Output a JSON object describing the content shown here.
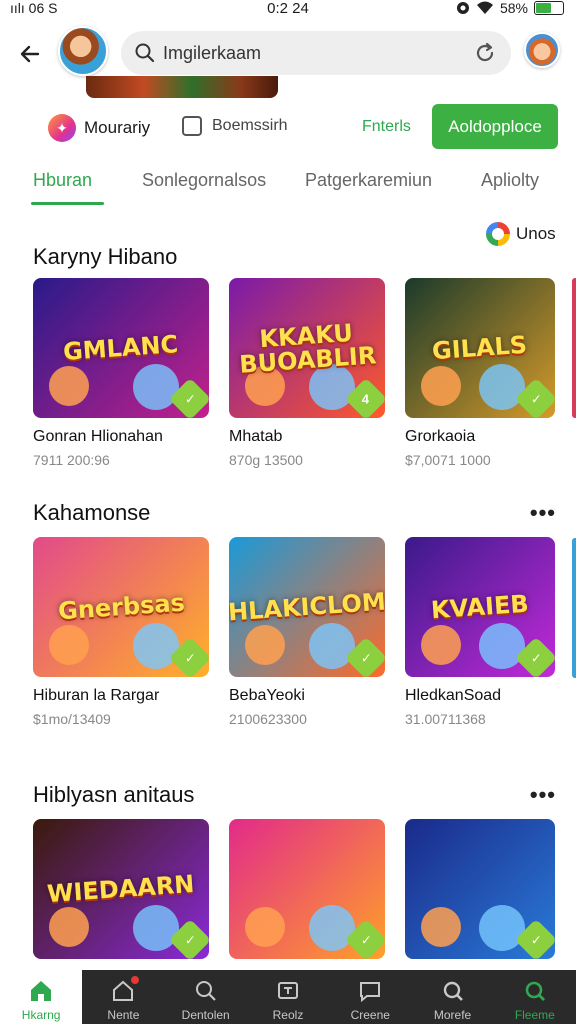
{
  "status_bar": {
    "carrier": "ıılı 06 S",
    "time": "0:2 24",
    "battery": "58%",
    "battery_level": 0.58
  },
  "header": {
    "search_value": "Imgilerkaam"
  },
  "filter_row": {
    "brand_label": "Mourariy",
    "checkbox_label": "Boemssirh",
    "filters_link": "Fnterls",
    "primary_button": "Aoldopploce"
  },
  "tabs": [
    {
      "label": "Hburan"
    },
    {
      "label": "Sonlegornalsos"
    },
    {
      "label": "Patgerkaremiun"
    },
    {
      "label": "Apliolty"
    }
  ],
  "brand_tag": "Unos",
  "sections": [
    {
      "title": "Karyny Hibano",
      "cards": [
        {
          "thumb_title": "GMLANC",
          "title": "Gonran Hlionahan",
          "subtitle": "7911 200:96",
          "badge": "✓",
          "colors": [
            "#2a1a8a",
            "#c2218c"
          ]
        },
        {
          "thumb_title": "KKAKU BUOABLIR",
          "title": "Mhatab",
          "subtitle": "870g 13500",
          "badge": "4",
          "colors": [
            "#7a1aa8",
            "#ff5a2a"
          ]
        },
        {
          "thumb_title": "GILALS",
          "title": "Grorkaoia",
          "subtitle": "$7,0071 1000",
          "badge": "✓",
          "colors": [
            "#1a3a2a",
            "#d69a2a"
          ]
        }
      ]
    },
    {
      "title": "Kahamonse",
      "more": "•••",
      "cards": [
        {
          "thumb_title": "Gnerbsas",
          "title": "Hiburan la Rargar",
          "subtitle": "$1mo/13409",
          "badge": "✓",
          "colors": [
            "#e24a8a",
            "#ffb02a"
          ]
        },
        {
          "thumb_title": "HLAKICLOM",
          "title": "BebaYeoki",
          "subtitle": "2100623300",
          "badge": "✓",
          "colors": [
            "#1a9ad8",
            "#ff6a2a"
          ]
        },
        {
          "thumb_title": "KVAIEB",
          "title": "HledkanSoad",
          "subtitle": "31.00711368",
          "badge": "✓",
          "colors": [
            "#3a1a8a",
            "#c22ad8"
          ]
        }
      ]
    },
    {
      "title": "Hiblyasn anitaus",
      "more": "•••",
      "cards": [
        {
          "thumb_title": "WIEDAARN",
          "title": "",
          "subtitle": "",
          "badge": "✓",
          "colors": [
            "#3a1a0a",
            "#8a2ad8"
          ]
        },
        {
          "thumb_title": "",
          "title": "",
          "subtitle": "",
          "badge": "✓",
          "colors": [
            "#e22a8a",
            "#ffa02a"
          ]
        },
        {
          "thumb_title": "",
          "title": "",
          "subtitle": "",
          "badge": "✓",
          "colors": [
            "#1a2a8a",
            "#2a7ad8"
          ]
        }
      ]
    }
  ],
  "bottom_nav": [
    {
      "label": "Hkarng",
      "icon": "home-icon"
    },
    {
      "label": "Nente",
      "icon": "house-outline-icon"
    },
    {
      "label": "Dentolen",
      "icon": "search-icon"
    },
    {
      "label": "Reolz",
      "icon": "tv-icon"
    },
    {
      "label": "Creene",
      "icon": "chat-icon"
    },
    {
      "label": "Morefe",
      "icon": "explore-icon"
    },
    {
      "label": "Fleeme",
      "icon": "search-green-icon"
    }
  ],
  "colors": {
    "accent": "#3cb043",
    "nav_background": "#2a2a2a",
    "search_bg": "#eeeeee"
  }
}
